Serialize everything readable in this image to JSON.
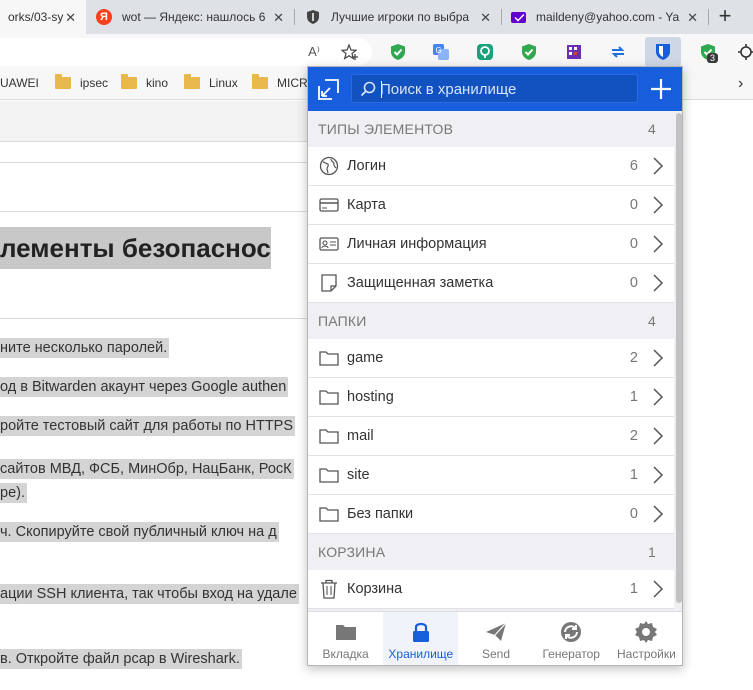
{
  "browser": {
    "tabs": [
      {
        "title": "orks/03-sy",
        "icon": "doc-icon"
      },
      {
        "title": "wot — Яндекс: нашлось 6",
        "icon": "yandex-icon"
      },
      {
        "title": "Лучшие игроки по выбра",
        "icon": "shield-icon"
      },
      {
        "title": "maildeny@yahoo.com - Ya",
        "icon": "yahoo-mail-icon"
      }
    ],
    "new_tab": "+",
    "toolbar_text": "A⁾",
    "badge_count": "3",
    "bookmarks": [
      {
        "label": "UAWEI"
      },
      {
        "label": "ipsec"
      },
      {
        "label": "kino"
      },
      {
        "label": "Linux"
      },
      {
        "label": "MICRO"
      }
    ]
  },
  "page": {
    "heading": "лементы безопаснос",
    "paragraphs": [
      "ните несколько паролей.",
      "од в Bitwarden акаунт через Google authen",
      "ройте тестовый сайт для работы по HTTPS",
      "сайтов МВД, ФСБ, МинОбр, НацБанк, РосК",
      "ре).",
      "ч. Скопируйте свой публичный ключ на д",
      "ации SSH клиента, так чтобы вход на удале",
      "в. Откройте файл pcap в Wireshark."
    ]
  },
  "popup": {
    "search_placeholder": "Поиск в хранилище",
    "types_section": {
      "title": "ТИПЫ ЭЛЕМЕНТОВ",
      "count": "4"
    },
    "types": [
      {
        "label": "Логин",
        "count": "6",
        "icon": "globe-icon"
      },
      {
        "label": "Карта",
        "count": "0",
        "icon": "credit-card-icon"
      },
      {
        "label": "Личная информация",
        "count": "0",
        "icon": "id-card-icon"
      },
      {
        "label": "Защищенная заметка",
        "count": "0",
        "icon": "note-icon"
      }
    ],
    "folders_section": {
      "title": "ПАПКИ",
      "count": "4"
    },
    "folders": [
      {
        "label": "game",
        "count": "2"
      },
      {
        "label": "hosting",
        "count": "1"
      },
      {
        "label": "mail",
        "count": "2"
      },
      {
        "label": "site",
        "count": "1"
      },
      {
        "label": "Без папки",
        "count": "0"
      }
    ],
    "trash_section": {
      "title": "КОРЗИНА",
      "count": "1"
    },
    "trash": [
      {
        "label": "Корзина",
        "count": "1"
      }
    ],
    "nav": [
      {
        "label": "Вкладка",
        "icon": "folder-tab-icon"
      },
      {
        "label": "Хранилище",
        "icon": "lock-icon"
      },
      {
        "label": "Send",
        "icon": "send-icon"
      },
      {
        "label": "Генератор",
        "icon": "generator-icon"
      },
      {
        "label": "Настройки",
        "icon": "gear-icon"
      }
    ],
    "accent_color": "#175ddc"
  }
}
